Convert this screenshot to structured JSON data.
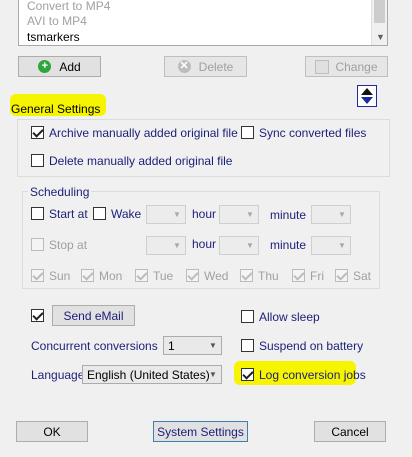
{
  "list": {
    "items": [
      "Convert to MP4",
      "AVI to MP4",
      "tsmarkers"
    ]
  },
  "toolbar": {
    "add_label": "Add",
    "delete_label": "Delete",
    "change_label": "Change"
  },
  "general": {
    "title": "General Settings",
    "archive_label": "Archive manually added original file",
    "archive_checked": true,
    "sync_label": "Sync converted files",
    "sync_checked": false,
    "delete_label": "Delete manually added original file",
    "delete_checked": false
  },
  "scheduling": {
    "title": "Scheduling",
    "start_label": "Start at",
    "wake_label": "Wake",
    "hour_label": "hour",
    "minute_label": "minute",
    "stop_label": "Stop at",
    "days": [
      "Sun",
      "Mon",
      "Tue",
      "Wed",
      "Thu",
      "Fri",
      "Sat"
    ]
  },
  "email": {
    "send_label": "Send eMail",
    "checked": true
  },
  "options": {
    "allow_sleep_label": "Allow sleep",
    "suspend_label": "Suspend on battery",
    "log_label": "Log conversion jobs",
    "log_checked": true
  },
  "concurrent": {
    "label": "Concurrent conversions",
    "value": "1"
  },
  "language": {
    "label": "Language",
    "value": "English (United States)"
  },
  "footer": {
    "ok_label": "OK",
    "system_settings_label": "System Settings",
    "cancel_label": "Cancel"
  },
  "colors": {
    "highlight": "#f7f400",
    "label_text": "#1b1f77",
    "add_icon": "#2ea63b"
  }
}
